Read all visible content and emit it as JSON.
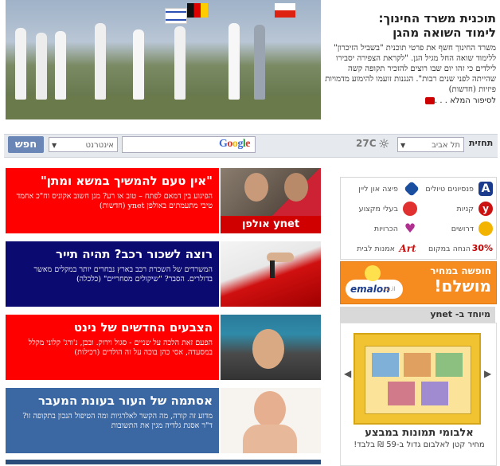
{
  "hero": {
    "title_line1": "תוכנית משרד החינוך:",
    "title_line2": "לימוד השואה מהגן",
    "body": "משרד החינוך חשף את פרטי תוכנית \"בשביל הזיכרון\" ללימוד שואה החל מגיל הגן. \"לקראת הצפירה יסבירו לילדים כי זהו יום שבו רוצים להזכיר תקופה קשה שהייתה לפני שנים רבות\". הנגנות זועמו להימוע מדמויות פיזיות",
    "body_tag": "(חדשות)",
    "more": "לסיפור המלא . . ."
  },
  "toolbar": {
    "forecast_label": "תחזית",
    "city": "תל אביב",
    "temperature": "27C",
    "search_label": "חפש",
    "scope": "אינטרנט",
    "google": "Google"
  },
  "promos": [
    {
      "title": "\"אין טעם להמשיך במשא ומתן\"",
      "body": "הפיגוע בין דמאם לפתח – טוב או רע? מגן חשוב אקוניס וח\"כ אחמד טיבי מתעמתים באולפן ynet (חדשות)",
      "pic_text": "אולפן ynet",
      "bg": "#ff0000"
    },
    {
      "title": "רוצה לשכור רכב? תהיה תייר",
      "body": "המשרדים של השכרת רכב בארץ נבחרים יותר במקלים מאשר בדולרים. הסבר? \"שיקולים מסחריים\" (כלכלה)",
      "pic_text": "",
      "bg": "#0a0a70"
    },
    {
      "title": "הצבעים החדשים של נינט",
      "body": "הפעם זאת הלכה על שניים - סגול וירוק. ובכן, נ'ורג' קלוני מקלל במסעדה, אסי כהן בוכה על זה הולדים (רכילות)",
      "pic_text": "",
      "bg": "#ff0000"
    },
    {
      "title": "אסתמה של העור בעונת המעבר",
      "body": "מדוע זה קורה, מה הקשר לאלרגיות ומה הטיפול הנכון בתקופה זו? ד\"ר אסנת גלדיה מגין את התשובות",
      "pic_text": "",
      "bg": "#3b67a3"
    }
  ],
  "services": [
    {
      "label": "פנסיונים טיולים",
      "color": "#1a3a8c"
    },
    {
      "label": "פיצה און ליין",
      "color": "#1a4fa0"
    },
    {
      "label": "קניות",
      "color": "#cc1111"
    },
    {
      "label": "בעלי מקצוע",
      "color": "#e03030"
    },
    {
      "label": "דרושים",
      "color": "#f2b400"
    },
    {
      "label": "הכרויות",
      "color": "#b03090"
    },
    {
      "label": "הנחה במקום",
      "color": "#cc0000"
    },
    {
      "label": "אמנות לבית",
      "color": "#cc1111"
    }
  ],
  "services_badges": {
    "a": "A",
    "y": "y",
    "pct": "30%",
    "art": "Art"
  },
  "emalon": {
    "top": "חופשה במחיר",
    "main": "מושלם!",
    "brand": "emalon",
    "brand_suffix": ".co.il"
  },
  "ynet_box": {
    "heading": "מיוחד ב- ynet",
    "album_title": "אלבומי תמונות במבצע",
    "album_body": "מחיר קטן לאלבום גדול ב-59 ₪ בלבד!"
  }
}
